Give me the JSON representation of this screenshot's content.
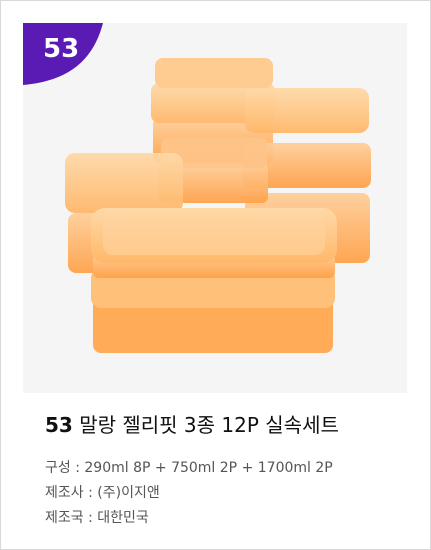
{
  "badge": {
    "number": "53",
    "color": "#5a1bb5"
  },
  "product": {
    "number": "53",
    "name": "말랑 젤리핏 3종 12P 실속세트",
    "image_alt": "orange jelly-fit storage containers set"
  },
  "specs": [
    {
      "label": "구성",
      "separator": " : ",
      "value": "290ml 8P + 750ml 2P + 1700ml 2P"
    },
    {
      "label": "제조사",
      "separator": " : ",
      "value": " (주)이지앤"
    },
    {
      "label": "제조국",
      "separator": " : ",
      "value": "대한민국"
    }
  ],
  "colors": {
    "container": "#ffb15c",
    "lid": "#ffc27a",
    "body": "#ff9f3a"
  }
}
